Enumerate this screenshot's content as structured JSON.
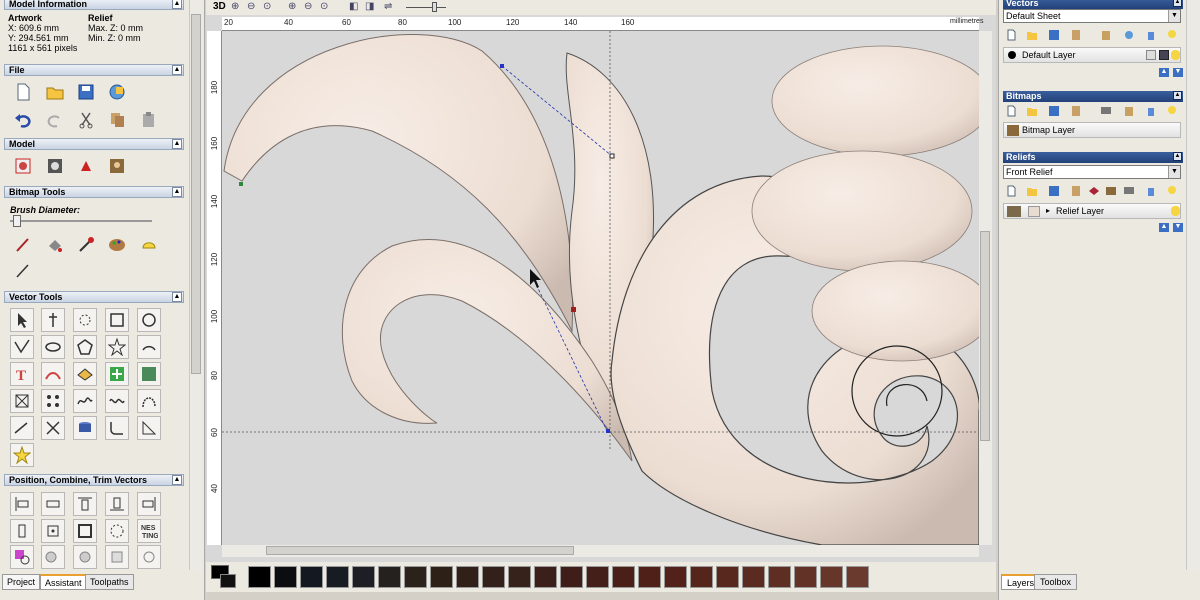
{
  "model_info": {
    "title": "Model Information",
    "artwork_label": "Artwork",
    "relief_label": "Relief",
    "x_size": "X: 609.6 mm",
    "y_size": "Y: 294.561 mm",
    "pixels": "1161 x 561 pixels",
    "max_z": "Max. Z: 0 mm",
    "min_z": "Min. Z: 0 mm"
  },
  "sections": {
    "file": "File",
    "model": "Model",
    "bitmap_tools": "Bitmap Tools",
    "brush_diameter": "Brush Diameter:",
    "vector_tools": "Vector Tools",
    "position": "Position, Combine, Trim Vectors"
  },
  "left_tabs": [
    "Project",
    "Assistant",
    "Toolpaths"
  ],
  "view_toolbar": {
    "mode_3d": "3D"
  },
  "ruler": {
    "h_ticks": [
      "20",
      "40",
      "60",
      "80",
      "100",
      "120",
      "140",
      "160"
    ],
    "v_ticks": [
      "180",
      "160",
      "140",
      "120",
      "100",
      "80",
      "60",
      "40"
    ],
    "units": "millimetres"
  },
  "right": {
    "vectors_title": "Vectors",
    "vectors_sheet": "Default Sheet",
    "vector_layer": "Default Layer",
    "bitmaps_title": "Bitmaps",
    "bitmap_layer": "Bitmap Layer",
    "reliefs_title": "Reliefs",
    "relief_combo": "Front Relief",
    "relief_layer": "Relief Layer",
    "tabs": [
      "Layers",
      "Toolbox"
    ]
  },
  "colors": {
    "relief": "#f0e2d8",
    "background": "#d8d8d8",
    "panel_header": "#22417a",
    "palette": [
      "#000000",
      "#0b0d10",
      "#141820",
      "#171b22",
      "#1d1f24",
      "#24211f",
      "#2a221b",
      "#2d2117",
      "#302018",
      "#33201a",
      "#36211b",
      "#3a1f1a",
      "#3f1e19",
      "#441e18",
      "#4a1f18",
      "#4e2018",
      "#52211a",
      "#55241b",
      "#58271e",
      "#5b2a20",
      "#5f2e23",
      "#633227",
      "#67362b",
      "#6b3a2f"
    ]
  },
  "icons": {
    "file": [
      "new-file-icon",
      "open-folder-icon",
      "save-icon",
      "import-icon",
      "undo-icon",
      "redo-icon",
      "cut-icon",
      "copy-icon",
      "paste-icon"
    ],
    "model": [
      "relief-icon",
      "model-icon",
      "calc-icon",
      "bitmap-icon"
    ]
  }
}
